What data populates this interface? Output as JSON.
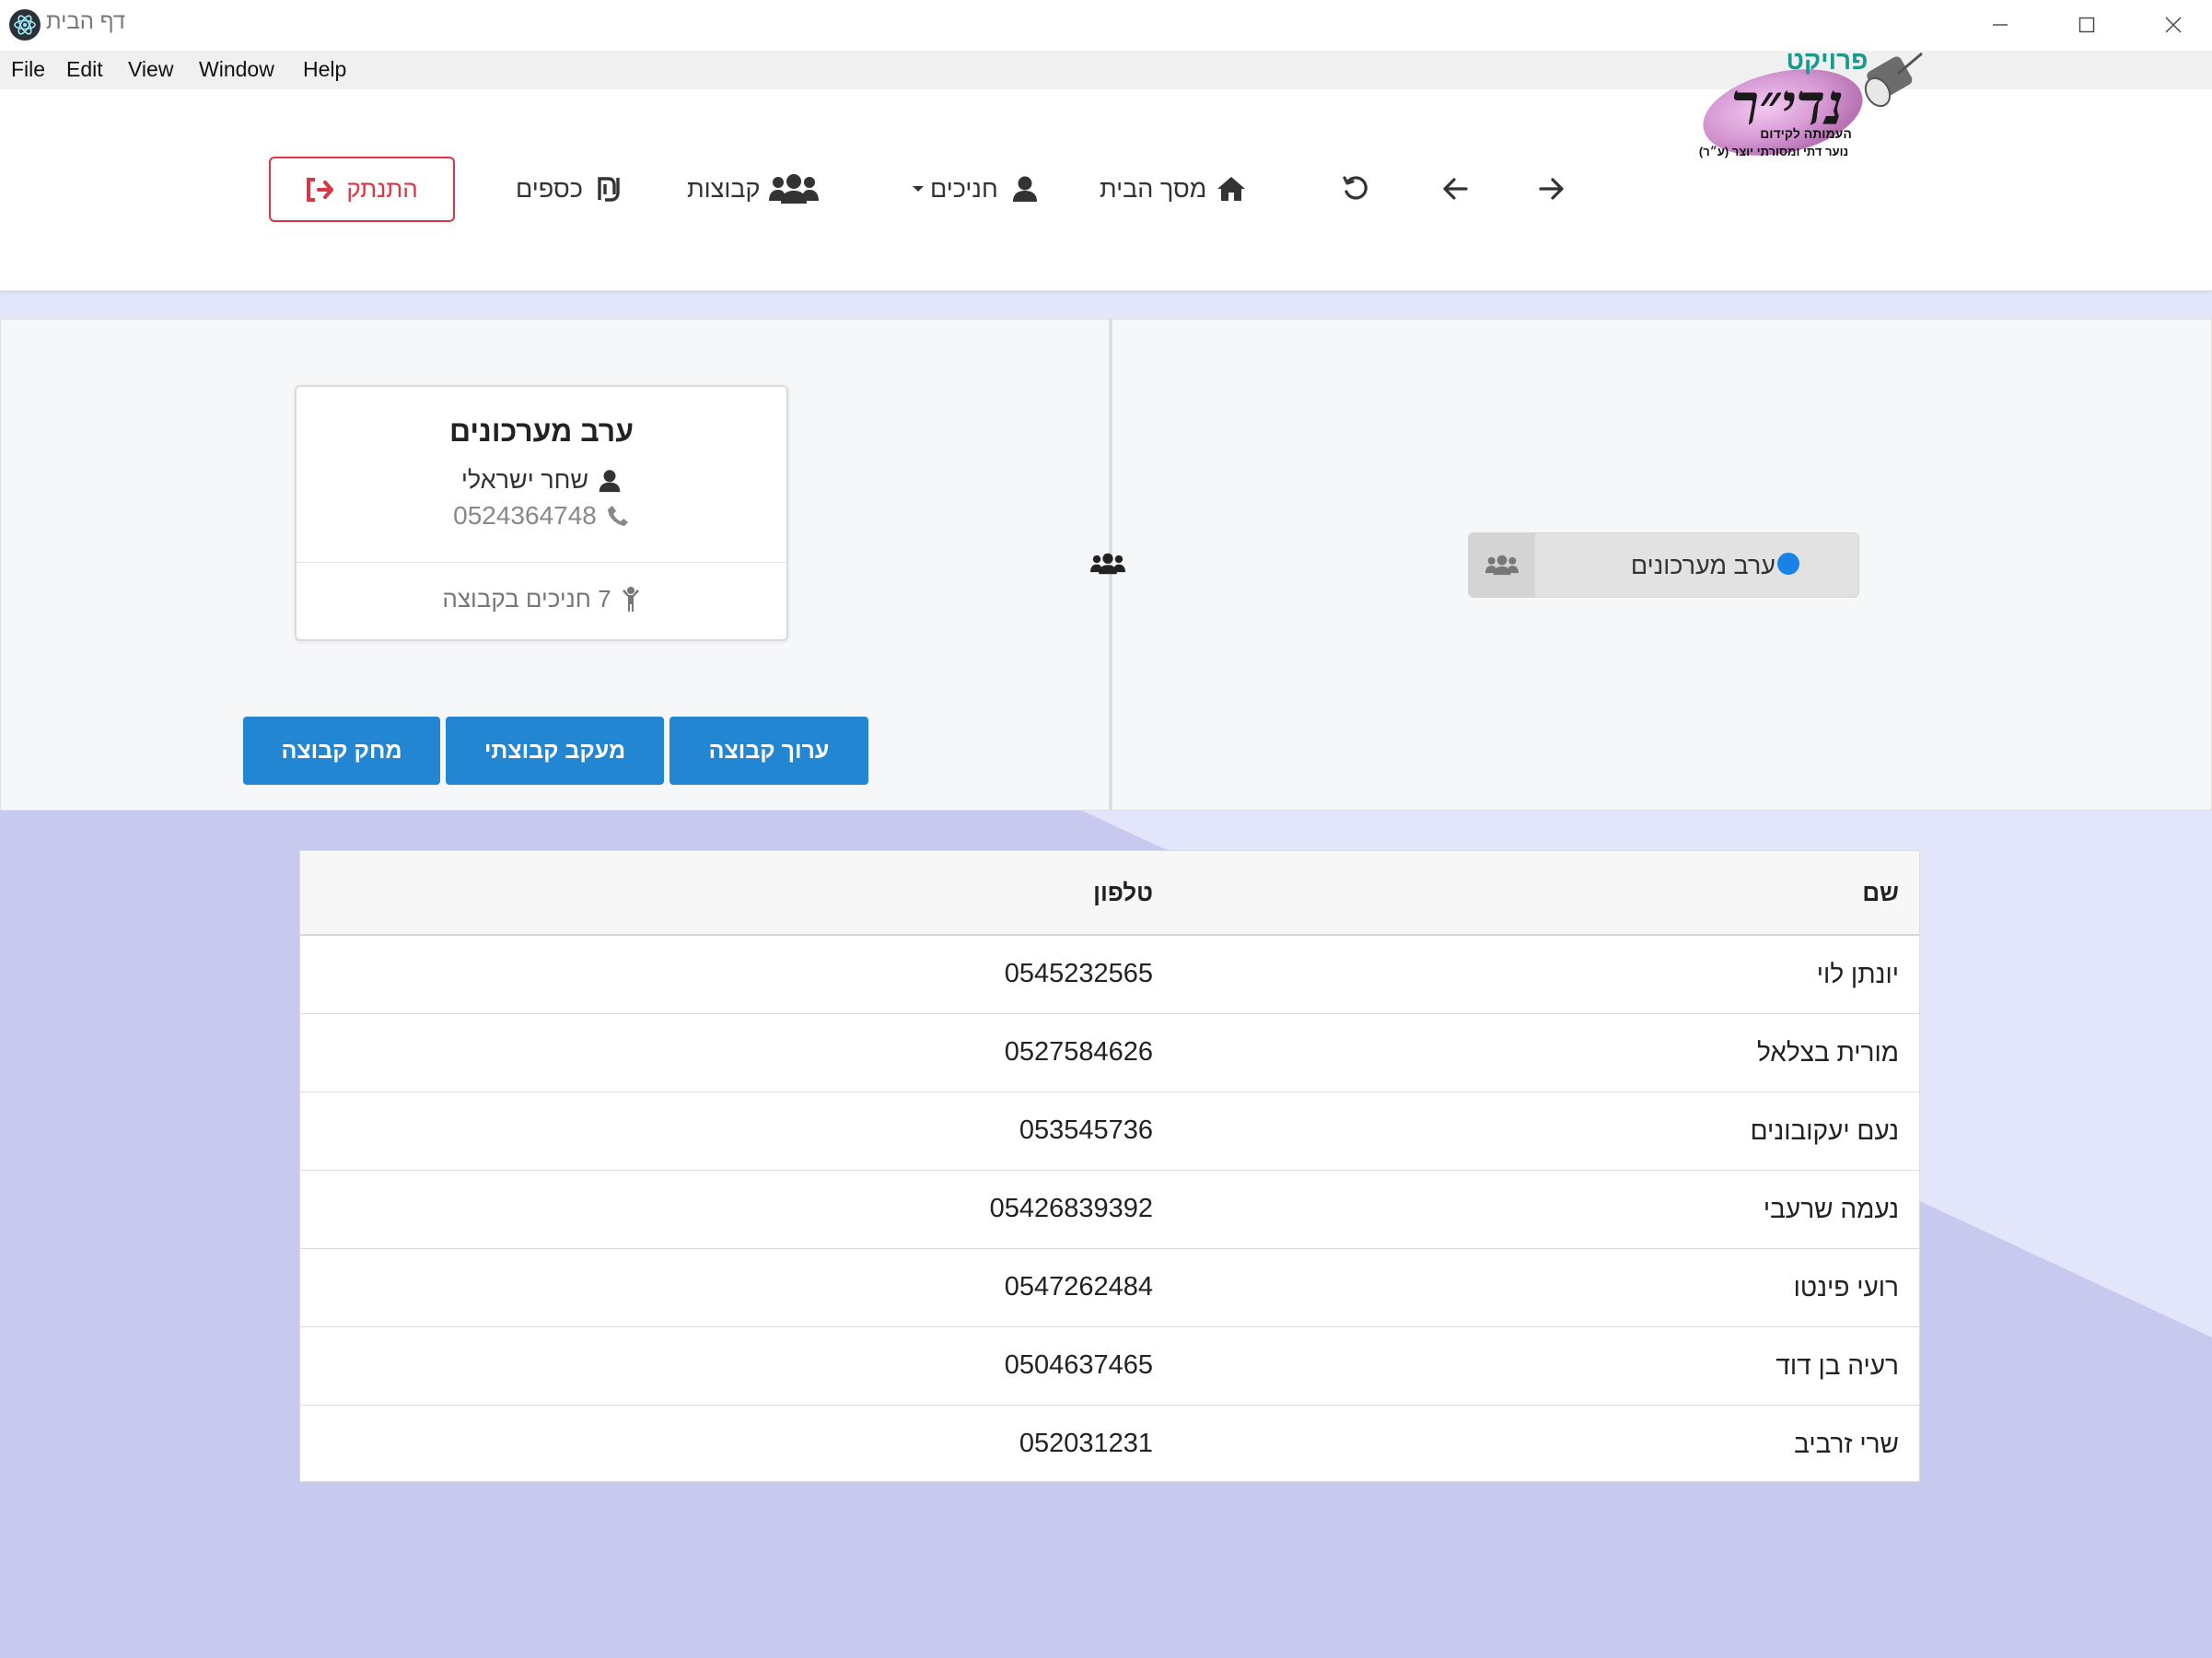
{
  "window": {
    "title": "דף הבית"
  },
  "menu": {
    "file": "File",
    "edit": "Edit",
    "view": "View",
    "window": "Window",
    "help": "Help"
  },
  "logo": {
    "line1": "פרויקט",
    "line2": "נדי״ר",
    "line3": "העמותה לקידום",
    "line4": "נוער דתי ומסורתי יוצר (ע״ר)"
  },
  "nav": {
    "home": "מסך הבית",
    "trainees": "חניכים",
    "groups": "קבוצות",
    "money": "כספים",
    "logout": "התנתק"
  },
  "group_card": {
    "title": "ערב מערכונים",
    "leader": "שחר ישראלי",
    "phone": "0524364748",
    "members": "7 חניכים בקבוצה"
  },
  "buttons": {
    "edit": "ערוך קבוצה",
    "tracking": "מעקב קבוצתי",
    "delete": "מחק קבוצה"
  },
  "group_list": [
    {
      "label": "ערב מערכונים"
    }
  ],
  "table": {
    "headers": {
      "name": "שם",
      "phone": "טלפון"
    },
    "rows": [
      {
        "name": "יונתן לוי",
        "phone": "0545232565"
      },
      {
        "name": "מורית בצלאל",
        "phone": "0527584626"
      },
      {
        "name": "נעם יעקובונים",
        "phone": "053545736"
      },
      {
        "name": "נעמה שרעבי",
        "phone": "05426839392"
      },
      {
        "name": "רועי פינטו",
        "phone": "0547262484"
      },
      {
        "name": "רעיה בן דוד",
        "phone": "0504637465"
      },
      {
        "name": "שרי זרביב",
        "phone": "052031231"
      }
    ]
  },
  "colors": {
    "accent": "#2286d3",
    "danger": "#dc3545",
    "bg": "#c7c9ef",
    "bg_light": "#e3e5fa",
    "status_dot": "#1a82e6"
  }
}
